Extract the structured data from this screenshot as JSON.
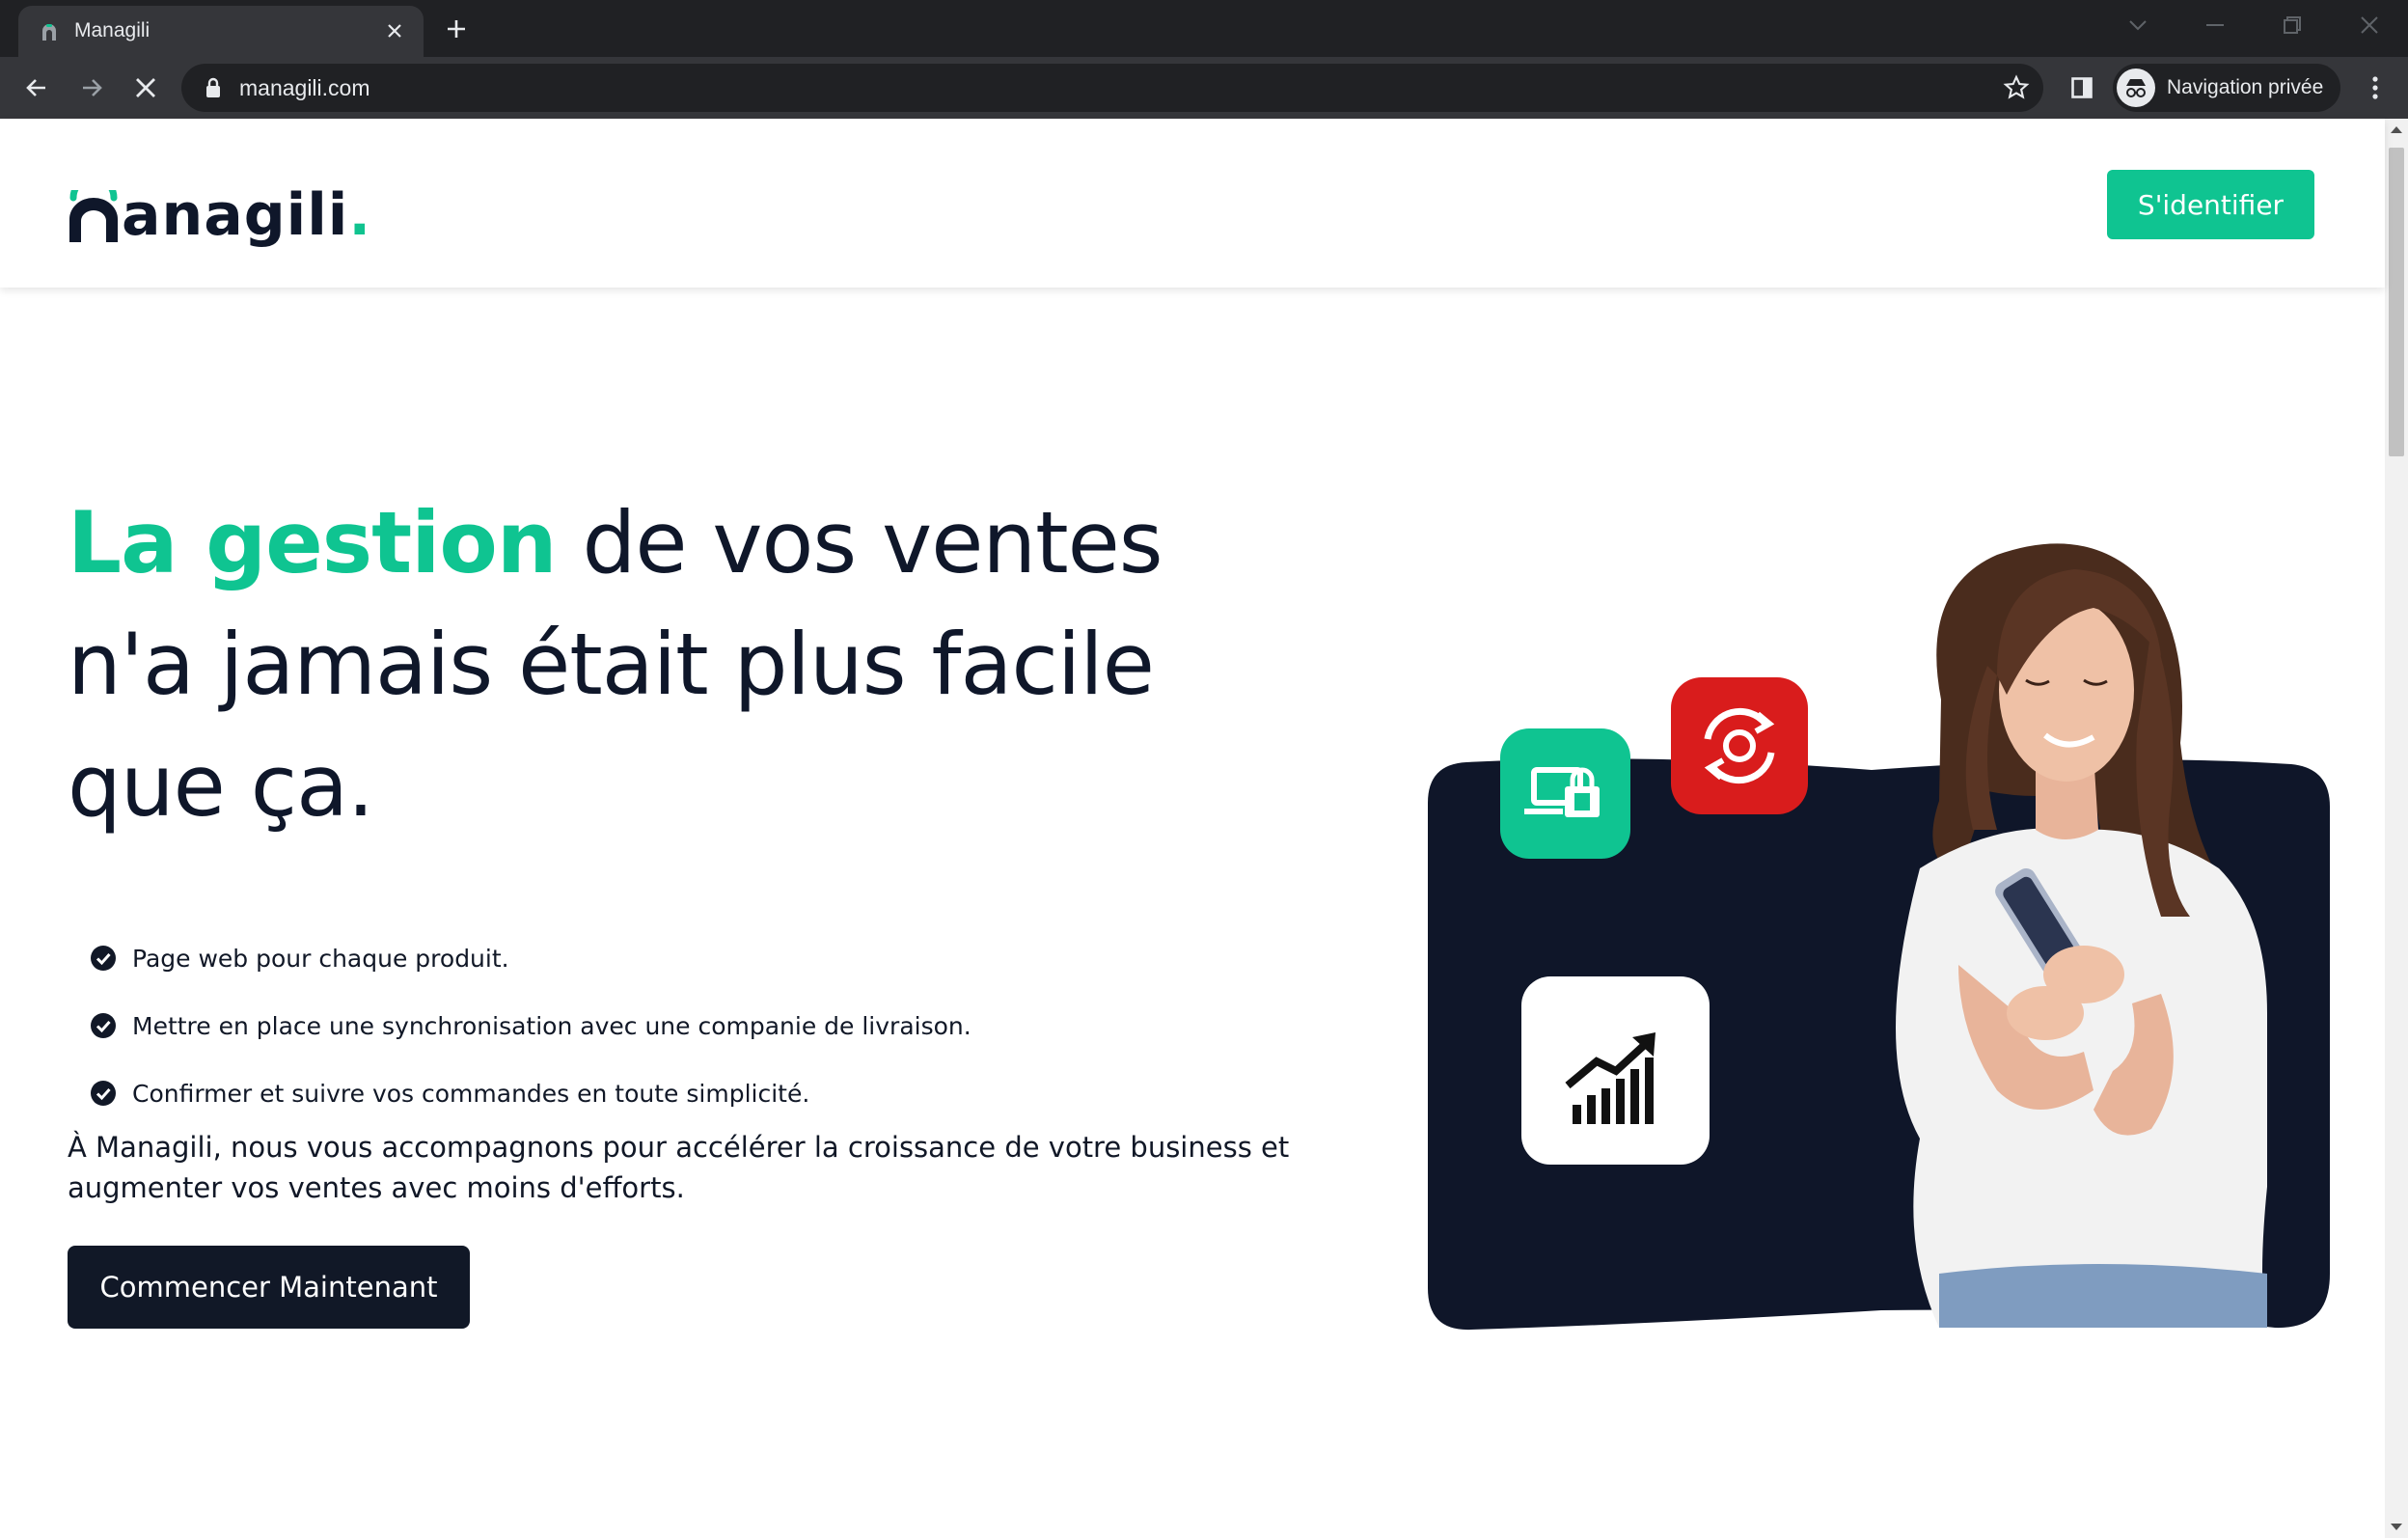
{
  "browser": {
    "tab_title": "Managili",
    "url": "managili.com",
    "profile_label": "Navigation privée",
    "icons": [
      "favicon-icon",
      "close-icon",
      "plus-icon",
      "back-icon",
      "forward-icon",
      "stop-icon",
      "lock-icon",
      "star-icon",
      "side-panel-icon",
      "incognito-icon",
      "more-vert-icon",
      "minimize-icon",
      "restore-icon",
      "window-close-icon",
      "tab-search-icon"
    ]
  },
  "header": {
    "logo_text": "anagili",
    "logo_dot": ".",
    "login_label": "S'identifier"
  },
  "hero": {
    "title_accent": "La gestion",
    "title_rest_1": " de vos ventes",
    "title_line_2": "n'a jamais était plus facile",
    "title_line_3": "que ça.",
    "features": [
      "Page web pour chaque produit.",
      "Mettre en place une synchronisation avec une companie de livraison.",
      "Confirmer et suivre vos commandes en toute simplicité."
    ],
    "description": "À Managili, nous vous accompagnons pour accélérer la croissance de votre business et augmenter vos ventes avec moins d'efforts.",
    "cta_label": "Commencer Maintenant"
  },
  "colors": {
    "accent": "#0fc491",
    "dark": "#0f172a",
    "panel": "#0f1629",
    "red": "#d91c1c"
  }
}
